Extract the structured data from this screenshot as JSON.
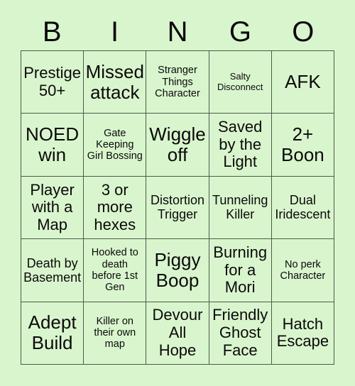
{
  "title": "BINGO",
  "header": {
    "letters": [
      "B",
      "I",
      "N",
      "G",
      "O"
    ]
  },
  "colors": {
    "page_background": "#d9f5cd",
    "cell_background": "#d9f5cd",
    "grid_line": "#4c5a4c",
    "text": "#0a0a0a"
  },
  "grid": {
    "rows": 5,
    "columns": 5,
    "cells": [
      {
        "text": "Prestige 50+",
        "size": "fs-lg"
      },
      {
        "text": "Missed attack",
        "size": "fs-xl"
      },
      {
        "text": "Stranger Things Character",
        "size": "fs-sm"
      },
      {
        "text": "Salty Disconnect",
        "size": "fs-xs"
      },
      {
        "text": "AFK",
        "size": "fs-xl"
      },
      {
        "text": "NOED win",
        "size": "fs-xl"
      },
      {
        "text": "Gate Keeping Girl Bossing",
        "size": "fs-sm"
      },
      {
        "text": "Wiggle off",
        "size": "fs-xl"
      },
      {
        "text": "Saved by the Light",
        "size": "fs-lg"
      },
      {
        "text": "2+ Boon",
        "size": "fs-xl"
      },
      {
        "text": "Player with a Map",
        "size": "fs-lg"
      },
      {
        "text": "3 or more hexes",
        "size": "fs-lg"
      },
      {
        "text": "Distortion Trigger",
        "size": "fs-md"
      },
      {
        "text": "Tunneling Killer",
        "size": "fs-md"
      },
      {
        "text": "Dual Iridescent",
        "size": "fs-md"
      },
      {
        "text": "Death by Basement",
        "size": "fs-md"
      },
      {
        "text": "Hooked to death before 1st Gen",
        "size": "fs-sm"
      },
      {
        "text": "Piggy Boop",
        "size": "fs-xl"
      },
      {
        "text": "Burning for a Mori",
        "size": "fs-lg"
      },
      {
        "text": "No perk Character",
        "size": "fs-sm"
      },
      {
        "text": "Adept Build",
        "size": "fs-xl"
      },
      {
        "text": "Killer on their own map",
        "size": "fs-sm"
      },
      {
        "text": "Devour All Hope",
        "size": "fs-lg"
      },
      {
        "text": "Friendly Ghost Face",
        "size": "fs-lg"
      },
      {
        "text": "Hatch Escape",
        "size": "fs-lg"
      }
    ]
  }
}
